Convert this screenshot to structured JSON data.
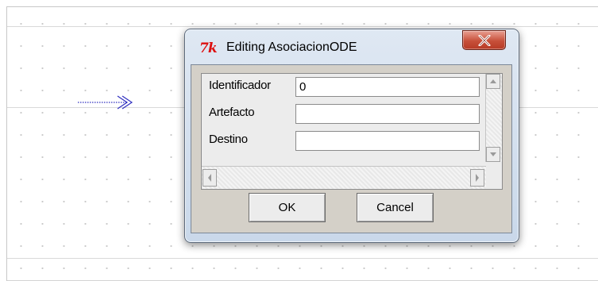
{
  "dialog": {
    "title": "Editing AsociacionODE",
    "app_icon": {
      "name": "tk-feather-icon",
      "glyph": "7k"
    }
  },
  "form": {
    "fields": [
      {
        "label": "Identificador",
        "value": "0"
      },
      {
        "label": "Artefacto",
        "value": ""
      },
      {
        "label": "Destino",
        "value": ""
      }
    ]
  },
  "buttons": {
    "ok_label": "OK",
    "cancel_label": "Cancel"
  },
  "colors": {
    "close_button": "#c7503a",
    "connector_arrow": "#3030c0",
    "app_icon": "#dd1111"
  }
}
